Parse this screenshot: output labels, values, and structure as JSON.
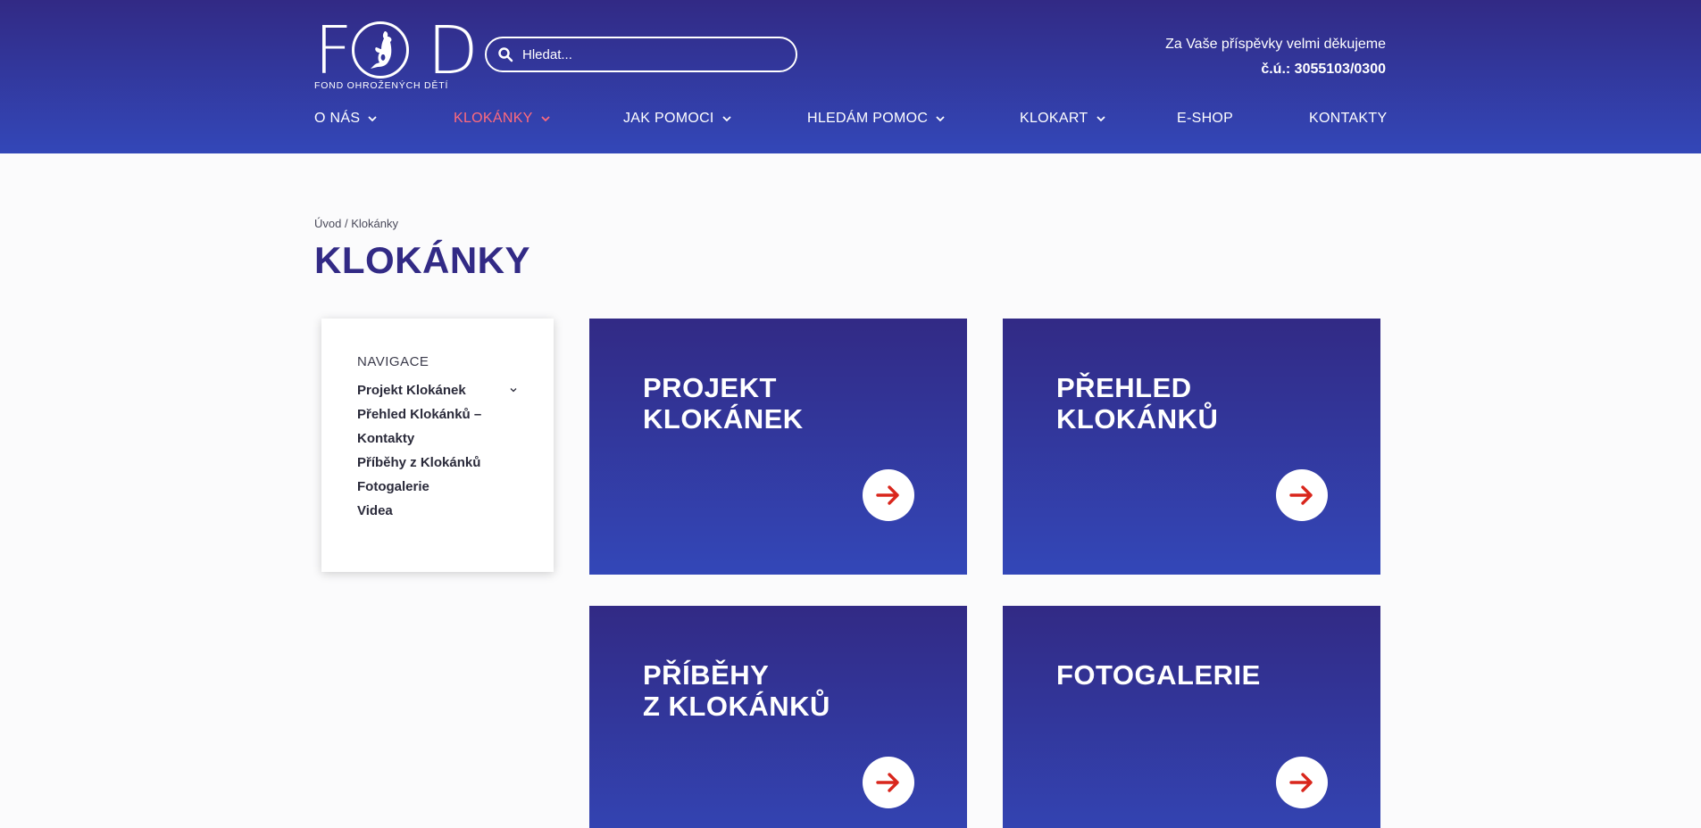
{
  "header": {
    "logo": {
      "letters": "FOD",
      "subtitle": "FOND OHROŽENÝCH DĚTÍ"
    },
    "search": {
      "placeholder": "Hledat..."
    },
    "donate": {
      "text": "Za Vaše příspěvky velmi děkujeme",
      "account": "č.ú.: 3055103/0300"
    },
    "nav": [
      {
        "label": "O NÁS",
        "has_dropdown": true,
        "active": false
      },
      {
        "label": "KLOKÁNKY",
        "has_dropdown": true,
        "active": true
      },
      {
        "label": "JAK POMOCI",
        "has_dropdown": true,
        "active": false
      },
      {
        "label": "HLEDÁM POMOC",
        "has_dropdown": true,
        "active": false
      },
      {
        "label": "KLOKART",
        "has_dropdown": true,
        "active": false
      },
      {
        "label": "E-SHOP",
        "has_dropdown": false,
        "active": false
      },
      {
        "label": "KONTAKTY",
        "has_dropdown": false,
        "active": false
      }
    ]
  },
  "breadcrumb": {
    "home": "Úvod",
    "separator": "/",
    "current": "Klokánky"
  },
  "page_title": "KLOKÁNKY",
  "sidenav": {
    "heading": "NAVIGACE",
    "items": [
      {
        "label": "Projekt Klokánek",
        "has_dropdown": true
      },
      {
        "label": "Přehled Klokánků – Kontakty",
        "has_dropdown": false
      },
      {
        "label": "Příběhy z Klokánků",
        "has_dropdown": false
      },
      {
        "label": "Fotogalerie",
        "has_dropdown": false
      },
      {
        "label": "Videa",
        "has_dropdown": false
      }
    ]
  },
  "tiles": [
    {
      "title": "PROJEKT\nKLOKÁNEK",
      "icon": "arrow-right-icon"
    },
    {
      "title": "PŘEHLED\nKLOKÁNKŮ",
      "icon": "arrow-right-icon"
    },
    {
      "title": "PŘÍBĚHY\nZ KLOKÁNKŮ",
      "icon": "arrow-right-icon"
    },
    {
      "title": "FOTOGALERIE",
      "icon": "arrow-right-icon"
    }
  ],
  "colors": {
    "header_gradient_top": "#322a85",
    "header_gradient_bottom": "#3347b8",
    "active_nav": "#ff6b7d",
    "title": "#322a85",
    "arrow": "#d9261c"
  }
}
